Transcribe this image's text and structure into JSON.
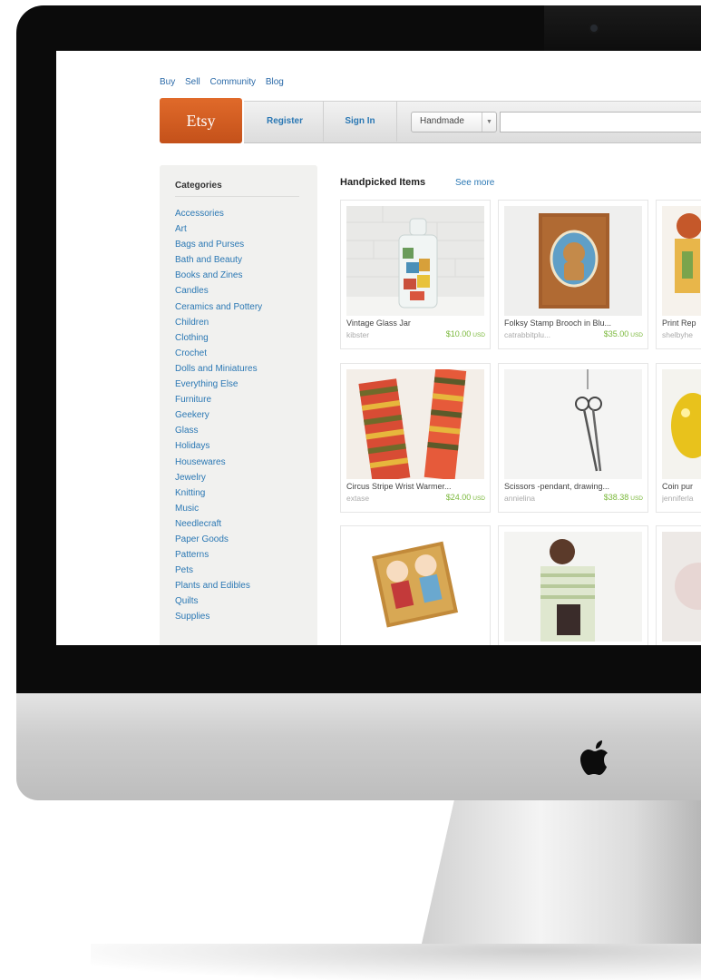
{
  "topnav": {
    "buy": "Buy",
    "sell": "Sell",
    "community": "Community",
    "blog": "Blog"
  },
  "header": {
    "logo": "Etsy",
    "register": "Register",
    "signin": "Sign In",
    "search_select": "Handmade",
    "search_placeholder": ""
  },
  "sidebar": {
    "title": "Categories",
    "items": [
      "Accessories",
      "Art",
      "Bags and Purses",
      "Bath and Beauty",
      "Books and Zines",
      "Candles",
      "Ceramics and Pottery",
      "Children",
      "Clothing",
      "Crochet",
      "Dolls and Miniatures",
      "Everything Else",
      "Furniture",
      "Geekery",
      "Glass",
      "Holidays",
      "Housewares",
      "Jewelry",
      "Knitting",
      "Music",
      "Needlecraft",
      "Paper Goods",
      "Patterns",
      "Pets",
      "Plants and Edibles",
      "Quilts",
      "Supplies"
    ]
  },
  "main": {
    "title": "Handpicked Items",
    "see_more": "See more",
    "items": [
      {
        "title": "Vintage Glass Jar",
        "shop": "kibster",
        "price": "$10.00",
        "currency": "USD"
      },
      {
        "title": "Folksy Stamp Brooch in Blu...",
        "shop": "catrabbitplu...",
        "price": "$35.00",
        "currency": "USD"
      },
      {
        "title": "Print Rep",
        "shop": "shelbyhe",
        "price": "",
        "currency": ""
      },
      {
        "title": "Circus Stripe Wrist Warmer...",
        "shop": "extase",
        "price": "$24.00",
        "currency": "USD"
      },
      {
        "title": "Scissors -pendant, drawing...",
        "shop": "annielina",
        "price": "$38.38",
        "currency": "USD"
      },
      {
        "title": "Coin pur",
        "shop": "jenniferla",
        "price": "",
        "currency": ""
      },
      {
        "title": "",
        "shop": "",
        "price": "",
        "currency": ""
      },
      {
        "title": "",
        "shop": "",
        "price": "",
        "currency": ""
      },
      {
        "title": "",
        "shop": "",
        "price": "",
        "currency": ""
      }
    ]
  },
  "colors": {
    "accent": "#d35f21",
    "link": "#2b78b4",
    "price": "#7ab83b"
  },
  "icons": {
    "brand": "apple-logo-icon",
    "select_arrow": "chevron-down-icon"
  }
}
